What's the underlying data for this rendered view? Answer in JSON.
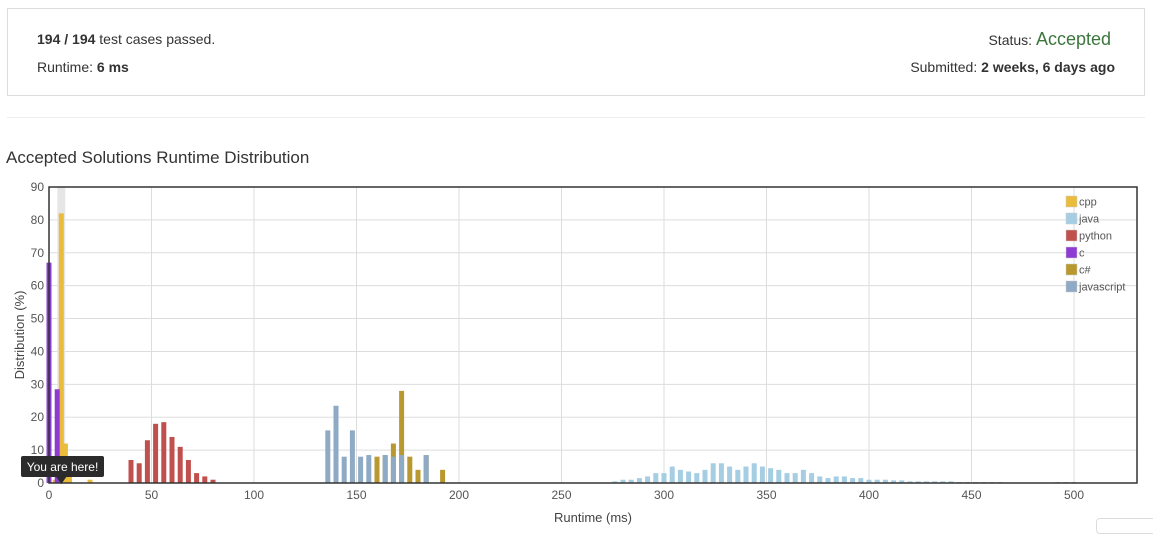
{
  "summary": {
    "passed": "194",
    "sep": " / ",
    "total": "194",
    "passed_text": " test cases passed.",
    "runtime_label": "Runtime: ",
    "runtime_value": "6 ms",
    "status_label": "Status: ",
    "status_value": "Accepted",
    "submitted_label": "Submitted: ",
    "submitted_value": "2 weeks, 6 days ago"
  },
  "chart_title": "Accepted Solutions Runtime Distribution",
  "chart_data": {
    "type": "bar",
    "title": "Accepted Solutions Runtime Distribution",
    "xlabel": "Runtime (ms)",
    "ylabel": "Distribution (%)",
    "xlim": [
      0,
      530
    ],
    "ylim": [
      0,
      90
    ],
    "xticks": [
      0,
      50,
      100,
      150,
      200,
      250,
      300,
      350,
      400,
      450,
      500
    ],
    "yticks": [
      0,
      10,
      20,
      30,
      40,
      50,
      60,
      70,
      80,
      90
    ],
    "grid": true,
    "legend_position": "top-right",
    "annotation": {
      "text": "You are here!",
      "x": 6
    },
    "highlight_x": 6,
    "series": [
      {
        "name": "cpp",
        "color": "#e9bc3c",
        "points": [
          [
            3,
            1
          ],
          [
            6,
            82
          ],
          [
            8,
            12
          ],
          [
            10,
            5
          ],
          [
            20,
            1
          ]
        ]
      },
      {
        "name": "java",
        "color": "#a6cee3",
        "points": [
          [
            276,
            0.5
          ],
          [
            280,
            1
          ],
          [
            284,
            1
          ],
          [
            288,
            1.5
          ],
          [
            292,
            2
          ],
          [
            296,
            3
          ],
          [
            300,
            3
          ],
          [
            304,
            5
          ],
          [
            308,
            4
          ],
          [
            312,
            3.5
          ],
          [
            316,
            3
          ],
          [
            320,
            4
          ],
          [
            324,
            6
          ],
          [
            328,
            6
          ],
          [
            332,
            5
          ],
          [
            336,
            4
          ],
          [
            340,
            5
          ],
          [
            344,
            6
          ],
          [
            348,
            5
          ],
          [
            352,
            4.5
          ],
          [
            356,
            4
          ],
          [
            360,
            3
          ],
          [
            364,
            3
          ],
          [
            368,
            4
          ],
          [
            372,
            3
          ],
          [
            376,
            2
          ],
          [
            380,
            1.5
          ],
          [
            384,
            2
          ],
          [
            388,
            2
          ],
          [
            392,
            1.5
          ],
          [
            396,
            1.5
          ],
          [
            400,
            1
          ],
          [
            404,
            1
          ],
          [
            408,
            1
          ],
          [
            412,
            0.8
          ],
          [
            416,
            0.8
          ],
          [
            420,
            0.5
          ],
          [
            424,
            0.5
          ],
          [
            428,
            0.5
          ],
          [
            432,
            0.5
          ],
          [
            436,
            0.5
          ],
          [
            440,
            0.5
          ],
          [
            444,
            0.3
          ],
          [
            448,
            0.3
          ],
          [
            452,
            0.3
          ],
          [
            456,
            0.3
          ],
          [
            460,
            0.3
          ],
          [
            464,
            0.3
          ],
          [
            492,
            0.3
          ],
          [
            496,
            0.3
          ],
          [
            500,
            0.3
          ]
        ]
      },
      {
        "name": "python",
        "color": "#c0504d",
        "points": [
          [
            40,
            7
          ],
          [
            44,
            6
          ],
          [
            48,
            13
          ],
          [
            52,
            18
          ],
          [
            56,
            18.5
          ],
          [
            60,
            14
          ],
          [
            64,
            11
          ],
          [
            68,
            7
          ],
          [
            72,
            3
          ],
          [
            76,
            2
          ],
          [
            80,
            1
          ]
        ]
      },
      {
        "name": "c",
        "color": "#8c3cd3",
        "points": [
          [
            0,
            67
          ],
          [
            4,
            28.5
          ]
        ]
      },
      {
        "name": "c#",
        "color": "#b8982f",
        "points": [
          [
            148,
            1
          ],
          [
            160,
            8
          ],
          [
            164,
            8.5
          ],
          [
            168,
            12
          ],
          [
            172,
            28
          ],
          [
            176,
            8
          ],
          [
            180,
            4
          ],
          [
            184,
            8.5
          ],
          [
            192,
            4
          ]
        ]
      },
      {
        "name": "javascript",
        "color": "#8eaac4",
        "points": [
          [
            136,
            16
          ],
          [
            140,
            23.5
          ],
          [
            144,
            8
          ],
          [
            148,
            16
          ],
          [
            152,
            8
          ],
          [
            156,
            8.5
          ],
          [
            164,
            8.5
          ],
          [
            168,
            8
          ],
          [
            172,
            8.5
          ],
          [
            184,
            8.5
          ]
        ]
      }
    ]
  }
}
